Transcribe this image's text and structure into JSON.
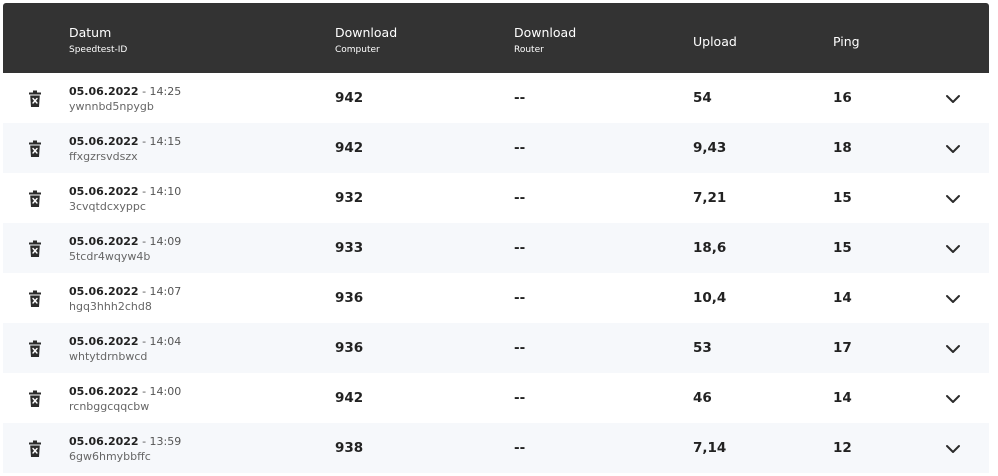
{
  "header": {
    "datum": "Datum",
    "speedtest_id": "Speedtest-ID",
    "download": "Download",
    "computer": "Computer",
    "download_router": "Download",
    "router": "Router",
    "upload": "Upload",
    "ping": "Ping"
  },
  "rows": [
    {
      "date": "05.06.2022",
      "time": " - 14:25",
      "id": "ywnnbd5npygb",
      "dl_computer": "942",
      "dl_router": "--",
      "upload": "54",
      "ping": "16"
    },
    {
      "date": "05.06.2022",
      "time": " - 14:15",
      "id": "ffxgzrsvdszx",
      "dl_computer": "942",
      "dl_router": "--",
      "upload": "9,43",
      "ping": "18"
    },
    {
      "date": "05.06.2022",
      "time": " - 14:10",
      "id": "3cvqtdcxyppc",
      "dl_computer": "932",
      "dl_router": "--",
      "upload": "7,21",
      "ping": "15"
    },
    {
      "date": "05.06.2022",
      "time": " - 14:09",
      "id": "5tcdr4wqyw4b",
      "dl_computer": "933",
      "dl_router": "--",
      "upload": "18,6",
      "ping": "15"
    },
    {
      "date": "05.06.2022",
      "time": " - 14:07",
      "id": "hgq3hhh2chd8",
      "dl_computer": "936",
      "dl_router": "--",
      "upload": "10,4",
      "ping": "14"
    },
    {
      "date": "05.06.2022",
      "time": " - 14:04",
      "id": "whtytdrnbwcd",
      "dl_computer": "936",
      "dl_router": "--",
      "upload": "53",
      "ping": "17"
    },
    {
      "date": "05.06.2022",
      "time": " - 14:00",
      "id": "rcnbggcqqcbw",
      "dl_computer": "942",
      "dl_router": "--",
      "upload": "46",
      "ping": "14"
    },
    {
      "date": "05.06.2022",
      "time": " - 13:59",
      "id": "6gw6hmybbffc",
      "dl_computer": "938",
      "dl_router": "--",
      "upload": "7,14",
      "ping": "12"
    }
  ],
  "icons": {
    "delete": "trash-icon",
    "expand": "chevron-down-icon"
  },
  "colors": {
    "header_bg": "#333333",
    "row_alt_bg": "#f6f8fb"
  }
}
